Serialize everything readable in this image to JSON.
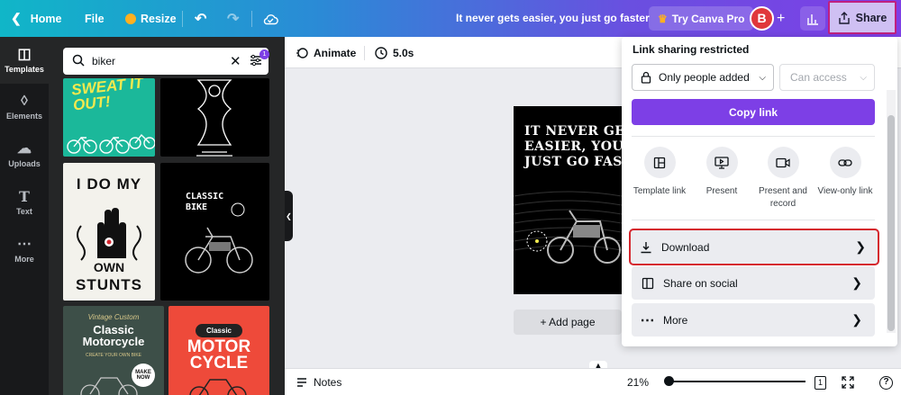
{
  "topbar": {
    "home": "Home",
    "file": "File",
    "resize": "Resize",
    "title": "It never gets easier, you just go faster",
    "try_pro": "Try Canva Pro",
    "avatar_initial": "B",
    "share": "Share"
  },
  "rail": {
    "items": [
      "Templates",
      "Elements",
      "Uploads",
      "Text",
      "More"
    ]
  },
  "search": {
    "value": "biker",
    "filter_count": "1"
  },
  "templates": {
    "t1_text": "SWEAT IT OUT!",
    "t3_text_top": "I DO MY",
    "t3_text_mid": "OWN",
    "t3_text_bottom": "STUNTS",
    "t4_text": "CLASSIC BIKE",
    "t5_small": "Vintage Custom",
    "t5_title": "Classic Motorcycle",
    "t5_sub": "CREATE YOUR OWN BIKE",
    "t5_badge": "MAKE NOW",
    "t6_label": "Classic",
    "t6_title_a": "MOTOR",
    "t6_title_b": "CYCLE"
  },
  "editor": {
    "animate": "Animate",
    "duration": "5.0s",
    "design_text": "IT NEVER GETS\nEASIER, YOU\nJUST GO FASTER",
    "add_page": "+ Add page",
    "notes": "Notes",
    "zoom": "21%",
    "page_number": "1"
  },
  "share_menu": {
    "title": "Link sharing restricted",
    "access_select": "Only people added",
    "permission_select": "Can access",
    "copy_link": "Copy link",
    "options": [
      {
        "label": "Template link"
      },
      {
        "label": "Present"
      },
      {
        "label": "Present and record"
      },
      {
        "label": "View-only link"
      }
    ],
    "download": "Download",
    "share_social": "Share on social",
    "more": "More"
  },
  "colors": {
    "accent": "#7d3fe6",
    "highlight": "#d5262e",
    "avatar": "#e0373b"
  }
}
